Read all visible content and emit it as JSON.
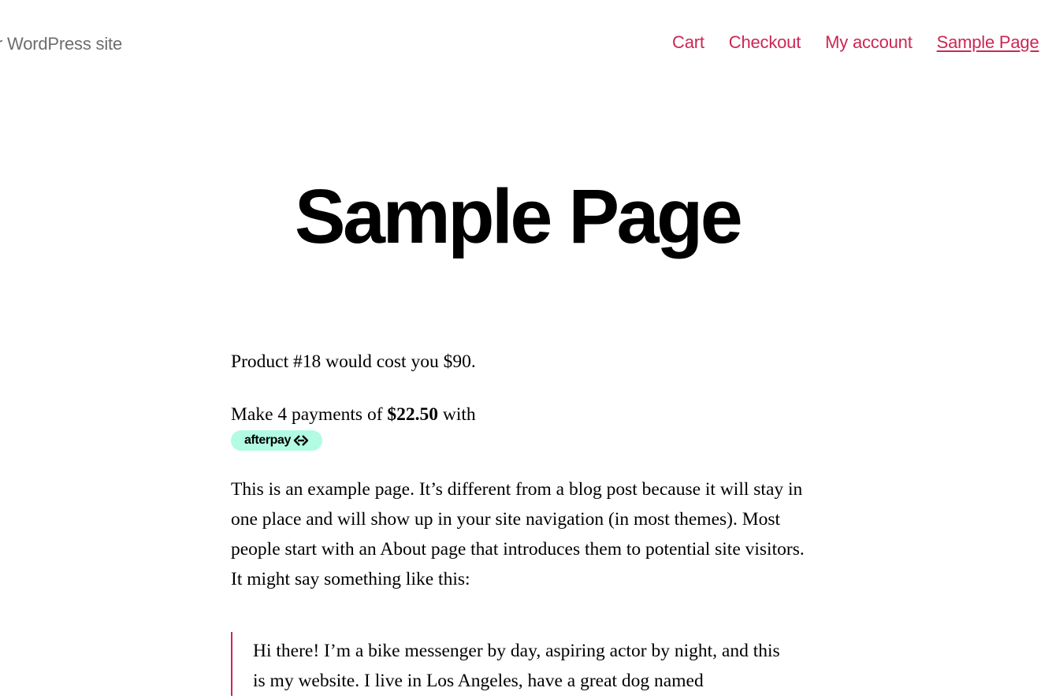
{
  "header": {
    "tagline": "r WordPress site",
    "nav": [
      {
        "label": "Cart",
        "current": false
      },
      {
        "label": "Checkout",
        "current": false
      },
      {
        "label": "My account",
        "current": false
      },
      {
        "label": "Sample Page",
        "current": true
      }
    ]
  },
  "page": {
    "title": "Sample Page",
    "price_line": "Product #18 would cost you $90.",
    "installment_prefix": "Make 4 payments of",
    "installment_amount": "$22.50",
    "installment_suffix": "with",
    "afterpay_label": "afterpay",
    "afterpay_icon": "afterpay-logo-icon",
    "body": "This is an example page. It’s different from a blog post because it will stay in one place and will show up in your site navigation (in most themes). Most people start with an About page that introduces them to potential site visitors. It might say something like this:",
    "quote": "Hi there! I’m a bike messenger by day, aspiring actor by night, and this is my website. I live in Los Angeles, have a great dog named"
  },
  "colors": {
    "accent": "#cd2653",
    "tagline": "#6d6d6d",
    "afterpay_bg": "#b2fce4"
  }
}
